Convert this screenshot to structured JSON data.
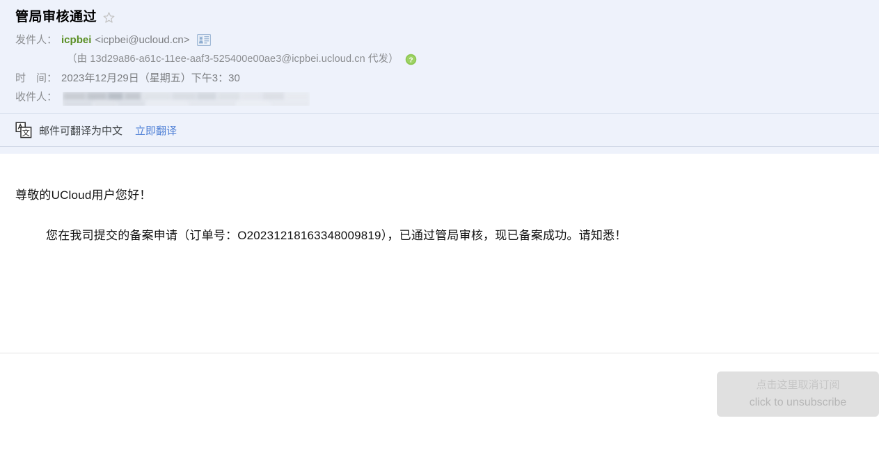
{
  "header": {
    "subject": "管局审核通过",
    "star_icon": "star-outline-icon",
    "sender_label": "发件人：",
    "sender_name": "icpbei",
    "sender_address": "<icpbei@ucloud.cn>",
    "contact_card_icon": "contact-card-icon",
    "delegate_text": "（由 13d29a86-a61c-11ee-aaf3-525400e00ae3@icpbei.ucloud.cn 代发）",
    "help_icon": "question-mark-icon",
    "time_label": "时　间：",
    "time_value": "2023年12月29日（星期五）下午3：30",
    "recipient_label": "收件人：",
    "recipient_value": ""
  },
  "translate_bar": {
    "icon": "translate-icon",
    "text": "邮件可翻译为中文",
    "link_label": "立即翻译"
  },
  "body": {
    "greeting": "尊敬的UCloud用户您好！",
    "paragraph": "您在我司提交的备案申请（订单号：O20231218163348009819），已通过管局审核，现已备案成功。请知悉！"
  },
  "footer": {
    "unsubscribe_cn": "点击这里取消订阅",
    "unsubscribe_en": "click to unsubscribe"
  },
  "colors": {
    "header_bg": "#eef2fb",
    "sender_green": "#5a8f24",
    "link_blue": "#4f80d6",
    "help_green": "#8cc751",
    "unsubscribe_bg": "#e0e0e0"
  }
}
